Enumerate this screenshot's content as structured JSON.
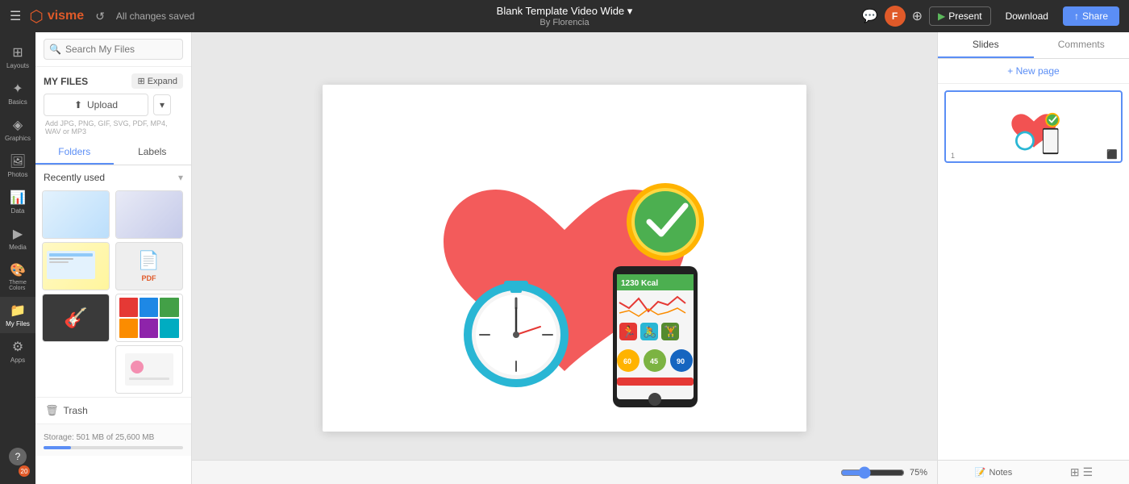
{
  "topbar": {
    "title": "Blank Template Video Wide",
    "title_arrow": "▾",
    "subtitle": "By Florencia",
    "saved_text": "All changes saved",
    "present_label": "Present",
    "download_label": "Download",
    "share_label": "Share",
    "share_icon": "↑",
    "avatar_letter": "F",
    "play_icon": "▶"
  },
  "left_rail": {
    "items": [
      {
        "id": "layouts",
        "icon": "⊞",
        "label": "Layouts"
      },
      {
        "id": "basics",
        "icon": "✦",
        "label": "Basics"
      },
      {
        "id": "graphics",
        "icon": "◈",
        "label": "Graphics"
      },
      {
        "id": "photos",
        "icon": "🖼",
        "label": "Photos"
      },
      {
        "id": "data",
        "icon": "📊",
        "label": "Data"
      },
      {
        "id": "media",
        "icon": "▶",
        "label": "Media"
      },
      {
        "id": "theme",
        "icon": "🎨",
        "label": "Theme Colors"
      },
      {
        "id": "myfiles",
        "icon": "📁",
        "label": "My Files"
      },
      {
        "id": "apps",
        "icon": "⚙",
        "label": "Apps"
      }
    ],
    "bottom_item": {
      "id": "help",
      "icon": "?",
      "label": "20"
    }
  },
  "left_panel": {
    "search_placeholder": "Search My Files",
    "my_files_label": "MY FILES",
    "expand_label": "Expand",
    "upload_label": "Upload",
    "upload_hint": "Add JPG, PNG, GIF, SVG, PDF, MP4, WAV or MP3",
    "folders_tab": "Folders",
    "labels_tab": "Labels",
    "recently_used_label": "Recently used",
    "trash_label": "Trash",
    "storage_text": "Storage: 501 MB of 25,600 MB"
  },
  "canvas": {
    "zoom_percent": "75%"
  },
  "right_panel": {
    "slides_tab": "Slides",
    "comments_tab": "Comments",
    "new_page_label": "+ New page",
    "slide_number": "1",
    "notes_label": "Notes"
  }
}
